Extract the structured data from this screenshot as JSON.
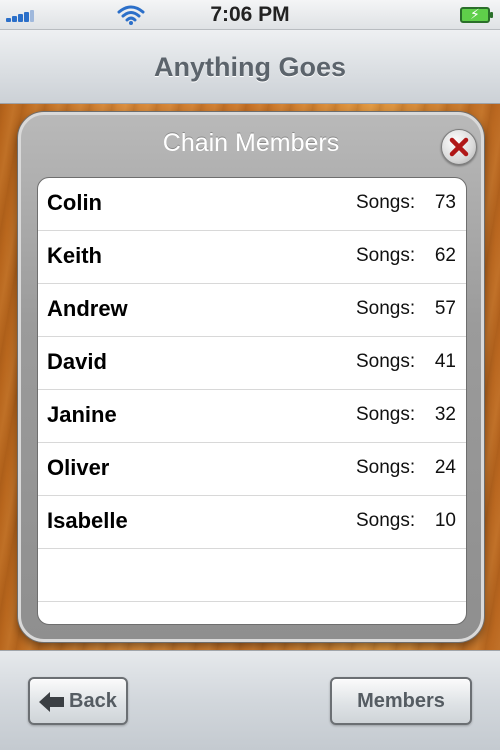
{
  "status_bar": {
    "time": "7:06 PM",
    "icons": [
      "signal-icon",
      "wifi-icon",
      "battery-charging-icon"
    ]
  },
  "nav": {
    "title": "Anything Goes"
  },
  "panel": {
    "title": "Chain Members",
    "close_icon": "close-icon",
    "members": [
      {
        "name": "Colin",
        "songs_label": "Songs:",
        "songs": "73"
      },
      {
        "name": "Keith",
        "songs_label": "Songs:",
        "songs": "62"
      },
      {
        "name": "Andrew",
        "songs_label": "Songs:",
        "songs": "57"
      },
      {
        "name": "David",
        "songs_label": "Songs:",
        "songs": "41"
      },
      {
        "name": "Janine",
        "songs_label": "Songs:",
        "songs": "32"
      },
      {
        "name": "Oliver",
        "songs_label": "Songs:",
        "songs": "24"
      },
      {
        "name": "Isabelle",
        "songs_label": "Songs:",
        "songs": "10"
      }
    ]
  },
  "toolbar": {
    "back_label": "Back",
    "members_label": "Members"
  },
  "colors": {
    "panel_gray": "#9b9b9b",
    "title_text": "#5c646c",
    "close_red": "#b01818",
    "wood": "#c97428"
  }
}
